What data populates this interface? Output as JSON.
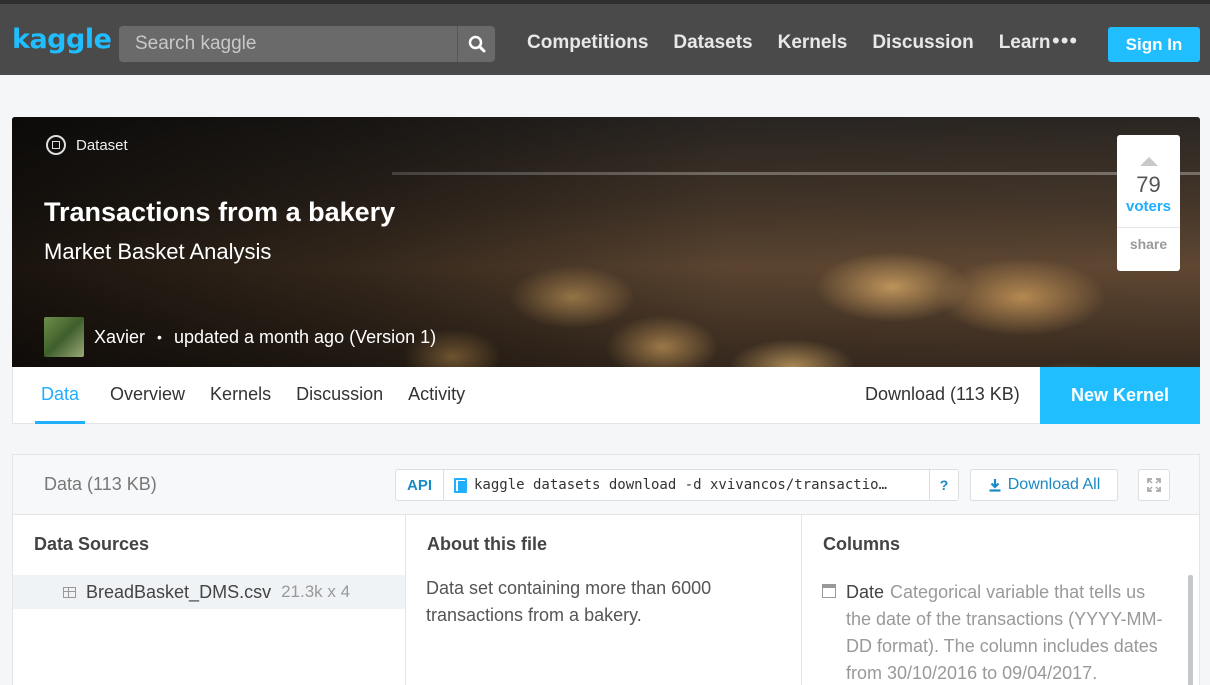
{
  "topbar": {
    "logo": "kaggle",
    "search_placeholder": "Search kaggle",
    "nav": [
      "Competitions",
      "Datasets",
      "Kernels",
      "Discussion",
      "Learn"
    ],
    "more": "•••",
    "signin": "Sign In"
  },
  "hero": {
    "type_label": "Dataset",
    "title": "Transactions from a bakery",
    "subtitle": "Market Basket Analysis",
    "author": "Xavier",
    "updated": "updated a month ago (Version 1)",
    "votes": "79",
    "voters_label": "voters",
    "share_label": "share"
  },
  "tabs": {
    "items": [
      "Data",
      "Overview",
      "Kernels",
      "Discussion",
      "Activity"
    ],
    "active": "Data",
    "download": "Download (113 KB)",
    "new_kernel": "New Kernel"
  },
  "data_panel": {
    "title": "Data (113 KB)",
    "api_label": "API",
    "api_command": "kaggle datasets download -d xvivancos/transactio…",
    "help": "?",
    "download_all": "Download All",
    "sources_heading": "Data Sources",
    "file": {
      "name": "BreadBasket_DMS.csv",
      "dims": "21.3k x 4"
    },
    "about_heading": "About this file",
    "about_text": "Data set containing more than 6000 transactions from a bakery.",
    "columns_heading": "Columns",
    "columns": [
      {
        "name": "Date",
        "description": "Categorical variable that tells us the date of the transactions (YYYY-MM-DD format). The column includes dates from 30/10/2016 to 09/04/2017."
      }
    ]
  },
  "colors": {
    "accent": "#20beff",
    "topbar": "#4a4a4a",
    "link": "#1a8ac4"
  }
}
